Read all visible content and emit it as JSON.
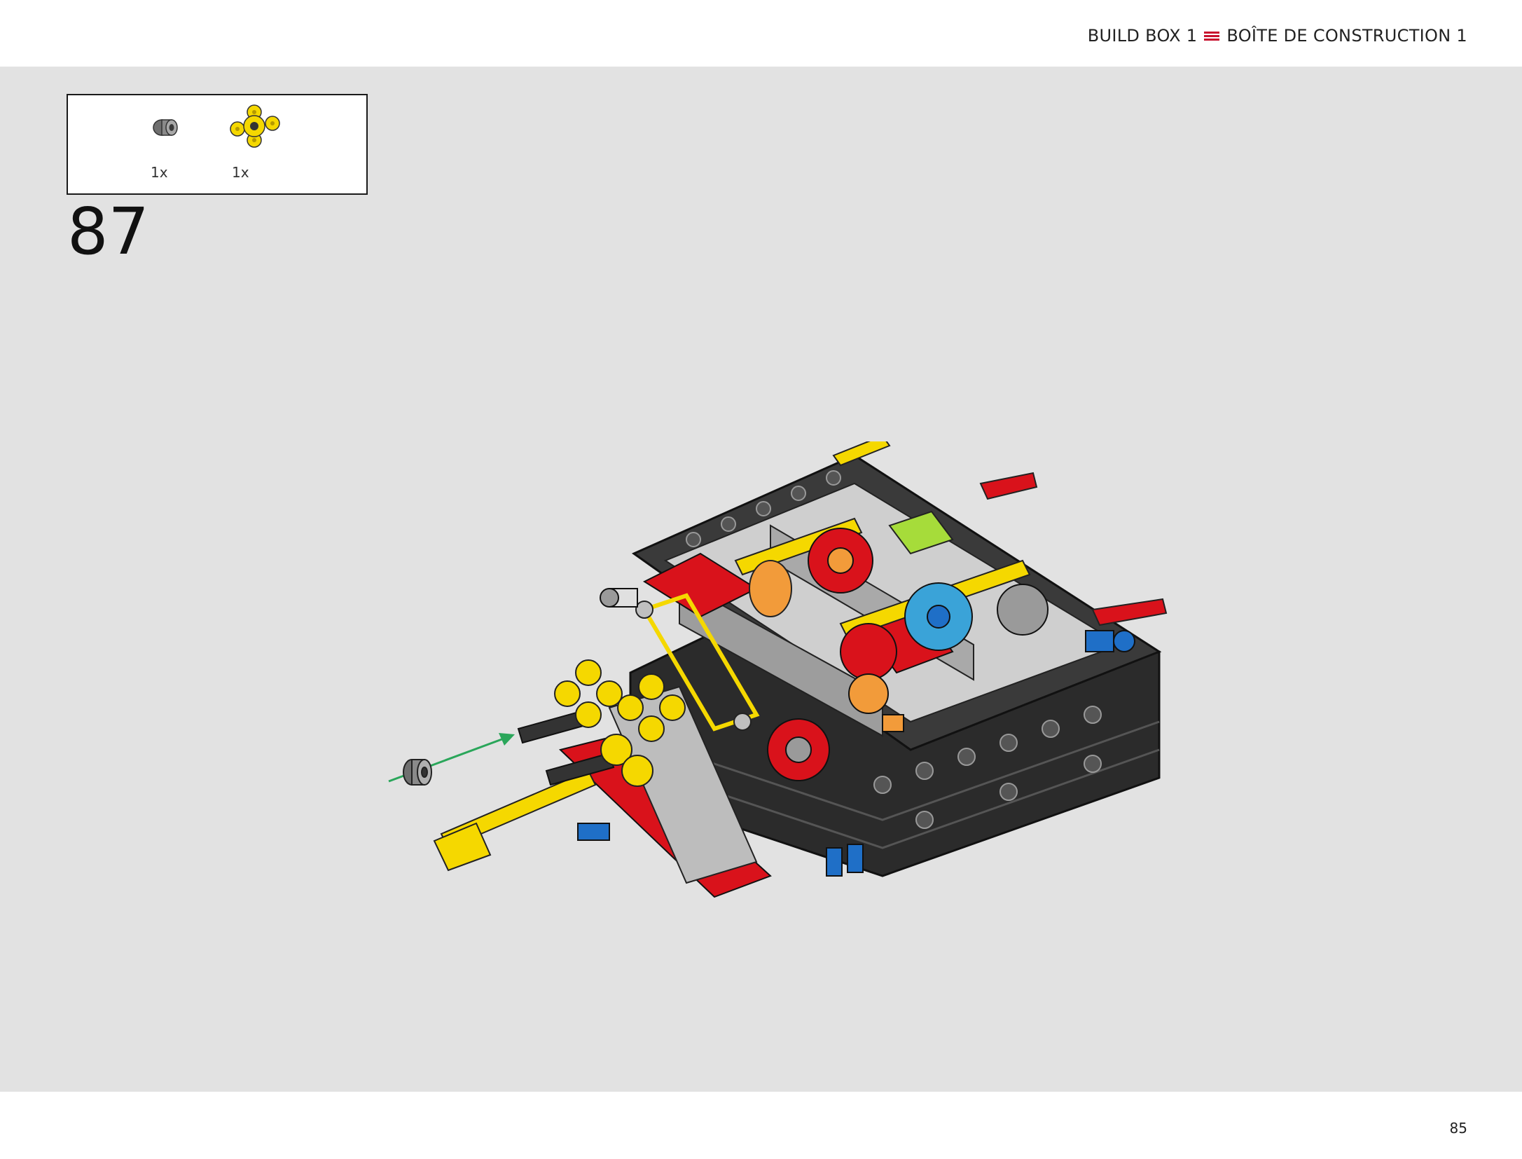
{
  "header": {
    "title_en": "BUILD BOX 1",
    "title_fr": "BOÎTE DE CONSTRUCTION 1",
    "separator_icon": "menu-lines-icon",
    "accent_color": "#c8102e"
  },
  "parts_list": {
    "items": [
      {
        "icon": "bush-gray-icon",
        "quantity": "1x",
        "color": "#9a9a9a"
      },
      {
        "icon": "gear-knob-yellow-icon",
        "quantity": "1x",
        "color": "#f5d000"
      }
    ]
  },
  "step": {
    "number": "87"
  },
  "illustration": {
    "icon": "gearbox-assembly-illustration",
    "colors": {
      "frame": "#2b2b2b",
      "light_gray": "#b8b8b8",
      "red": "#d9121b",
      "yellow": "#f5d800",
      "blue": "#1f6fc7",
      "azure": "#3aa3d8",
      "orange": "#f29b3a",
      "lime": "#a6dc3a",
      "arrow": "#2aa65a"
    }
  },
  "footer": {
    "page_number": "85"
  },
  "background": {
    "stage": "#e2e2e2",
    "page": "#ffffff"
  }
}
